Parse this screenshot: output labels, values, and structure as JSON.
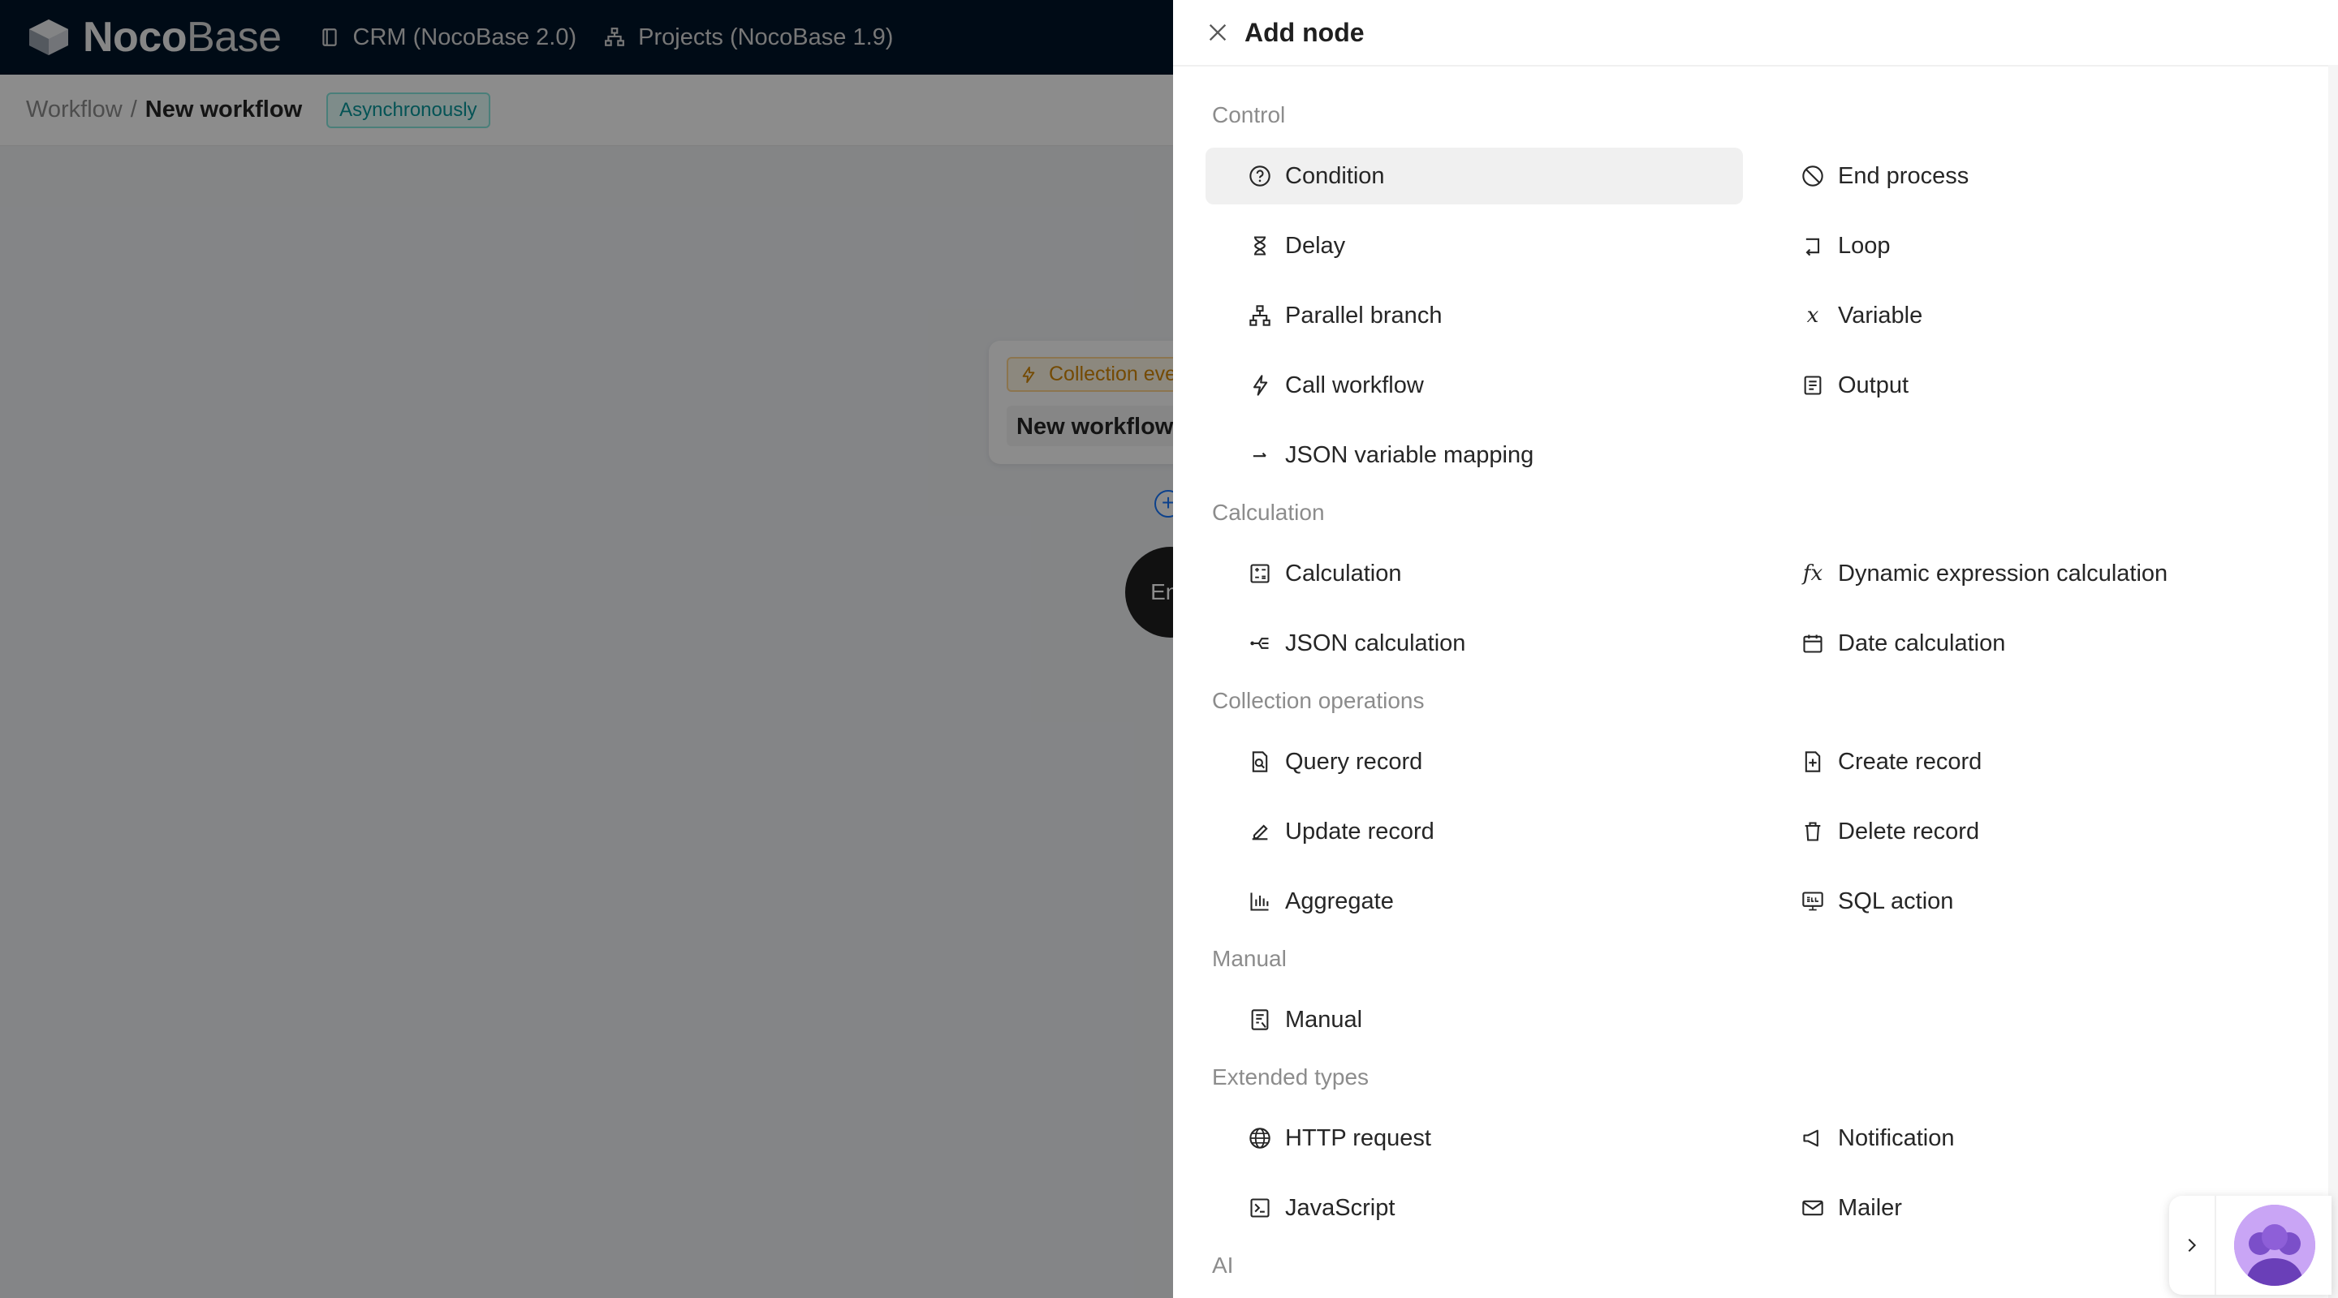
{
  "app": {
    "brand_bold": "Noco",
    "brand_light": "Base",
    "nav": [
      {
        "label": "CRM (NocoBase 2.0)",
        "icon": "book-icon"
      },
      {
        "label": "Projects (NocoBase 1.9)",
        "icon": "sitemap-icon"
      }
    ]
  },
  "breadcrumb": {
    "root": "Workflow",
    "separator": "/",
    "current": "New workflow",
    "mode_tag": "Asynchronously"
  },
  "canvas": {
    "trigger_tag": "Collection event",
    "trigger_title": "New workflow",
    "end_label": "End"
  },
  "drawer": {
    "title": "Add node",
    "groups": [
      {
        "label": "Control",
        "items": [
          {
            "label": "Condition",
            "icon": "question-circle-icon",
            "selected": true
          },
          {
            "label": "End process",
            "icon": "stop-icon"
          },
          {
            "label": "Delay",
            "icon": "hourglass-icon"
          },
          {
            "label": "Loop",
            "icon": "loop-icon"
          },
          {
            "label": "Parallel branch",
            "icon": "branches-icon"
          },
          {
            "label": "Variable",
            "icon": "variable-icon"
          },
          {
            "label": "Call workflow",
            "icon": "thunderbolt-icon"
          },
          {
            "label": "Output",
            "icon": "output-icon"
          },
          {
            "label": "JSON variable mapping",
            "icon": "arrow-right-icon"
          }
        ]
      },
      {
        "label": "Calculation",
        "items": [
          {
            "label": "Calculation",
            "icon": "calculator-icon"
          },
          {
            "label": "Dynamic expression calculation",
            "icon": "function-icon"
          },
          {
            "label": "JSON calculation",
            "icon": "json-calc-icon"
          },
          {
            "label": "Date calculation",
            "icon": "calendar-icon"
          }
        ]
      },
      {
        "label": "Collection operations",
        "items": [
          {
            "label": "Query record",
            "icon": "file-search-icon"
          },
          {
            "label": "Create record",
            "icon": "file-add-icon"
          },
          {
            "label": "Update record",
            "icon": "edit-icon"
          },
          {
            "label": "Delete record",
            "icon": "delete-icon"
          },
          {
            "label": "Aggregate",
            "icon": "bar-chart-icon"
          },
          {
            "label": "SQL action",
            "icon": "console-sql-icon"
          }
        ]
      },
      {
        "label": "Manual",
        "items": [
          {
            "label": "Manual",
            "icon": "form-icon"
          }
        ]
      },
      {
        "label": "Extended types",
        "items": [
          {
            "label": "HTTP request",
            "icon": "global-icon"
          },
          {
            "label": "Notification",
            "icon": "notification-icon"
          },
          {
            "label": "JavaScript",
            "icon": "code-icon"
          },
          {
            "label": "Mailer",
            "icon": "mail-icon"
          }
        ]
      },
      {
        "label": "AI",
        "items": []
      }
    ]
  }
}
